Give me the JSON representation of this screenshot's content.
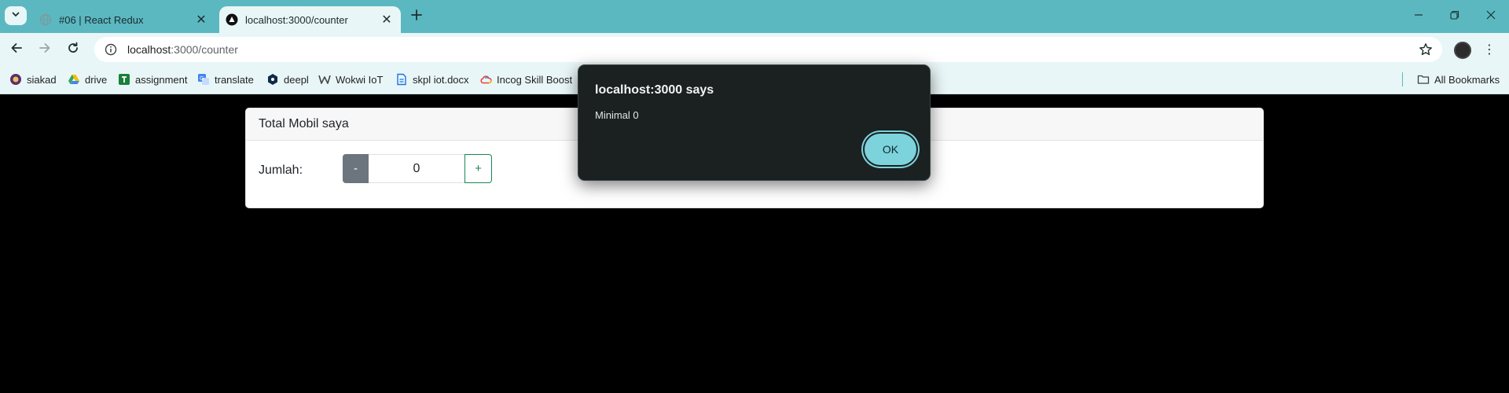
{
  "browser": {
    "tabs": [
      {
        "title": "#06 | React Redux",
        "icon": "globe-icon",
        "active": false
      },
      {
        "title": "localhost:3000/counter",
        "icon": "nextjs-triangle-icon",
        "active": true
      }
    ],
    "address": {
      "host": "localhost",
      "path": ":3000/counter"
    },
    "bookmarks": [
      {
        "label": "siakad",
        "icon": "university-icon"
      },
      {
        "label": "drive",
        "icon": "drive-icon"
      },
      {
        "label": "assignment",
        "icon": "assignment-icon"
      },
      {
        "label": "translate",
        "icon": "translate-icon"
      },
      {
        "label": "deepl",
        "icon": "deepl-icon"
      },
      {
        "label": "Wokwi IoT",
        "icon": "wokwi-icon"
      },
      {
        "label": "skpl iot.docx",
        "icon": "document-icon"
      },
      {
        "label": "Incog Skill Boost",
        "icon": "cloud-icon"
      }
    ],
    "all_bookmarks_label": "All Bookmarks",
    "colors": {
      "frame": "#5bb8c1",
      "toolbar": "#e9f6f7"
    }
  },
  "page": {
    "card_title": "Total Mobil saya",
    "count_label": "Jumlah:",
    "minus_label": "-",
    "count_value": "0",
    "plus_label": "+"
  },
  "dialog": {
    "title": "localhost:3000 says",
    "message": "Minimal 0",
    "ok_label": "OK"
  }
}
